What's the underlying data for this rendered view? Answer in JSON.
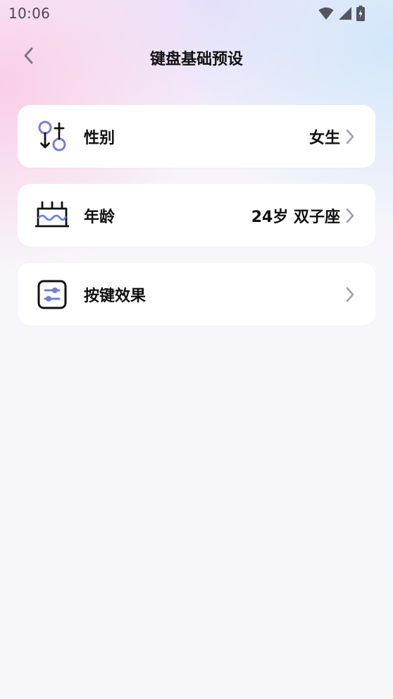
{
  "status_bar": {
    "time": "10:06",
    "icons": [
      "wifi-icon",
      "signal-icon",
      "battery-charging-icon"
    ]
  },
  "header": {
    "title": "键盘基础预设",
    "back_icon": "chevron-left-icon"
  },
  "settings": [
    {
      "id": "gender",
      "label": "性别",
      "value": "女生",
      "icon": "gender-icon"
    },
    {
      "id": "age",
      "label": "年龄",
      "value": "24岁 双子座",
      "icon": "birthday-cake-icon"
    },
    {
      "id": "key-effect",
      "label": "按键效果",
      "value": "",
      "icon": "sliders-icon"
    }
  ],
  "colors": {
    "accent": "#6f7fe0",
    "text": "#111111",
    "chevron": "#a0a0a8"
  }
}
